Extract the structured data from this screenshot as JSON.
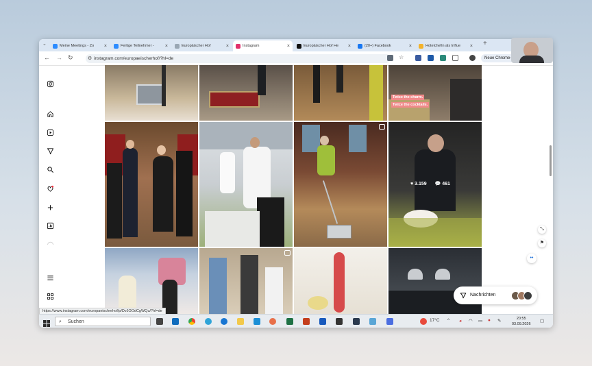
{
  "browser": {
    "tabs": [
      {
        "label": "Meine Meetings - Zo",
        "icon": "zoom-icon",
        "color": "#2d8cff"
      },
      {
        "label": "Fertige Teilnehmer -",
        "icon": "zoom-icon",
        "color": "#2d8cff"
      },
      {
        "label": "Europäischer Hof",
        "icon": "globe-icon",
        "color": "#9aa7b4"
      },
      {
        "label": "Instagram",
        "icon": "instagram-icon",
        "color": "#e1306c"
      },
      {
        "label": "Europäischer Hof He",
        "icon": "tiktok-icon",
        "color": "#111111"
      },
      {
        "label": "(20+) Facebook",
        "icon": "facebook-icon",
        "color": "#1877f2"
      },
      {
        "label": "Hotelchefin als Influe",
        "icon": "bookmark-icon",
        "color": "#f3b22b"
      }
    ],
    "new_tab": "+",
    "url": "instagram.com/europaeischerhof/?hl=de",
    "profile_label": "Neue Chrome-",
    "status_url": "https://www.instagram.com/europaeischerhof/p/DvJOOdCgWQu/?hl=de"
  },
  "instagram": {
    "sidebar": [
      "instagram-logo-icon",
      "home-icon",
      "reels-icon",
      "direct-icon",
      "search-icon",
      "notifications-icon",
      "create-icon",
      "dashboard-icon",
      "threads-icon",
      "menu-icon",
      "more-icon"
    ],
    "posts": [
      {
        "row": 0,
        "col": 0,
        "desc": "trolley"
      },
      {
        "row": 0,
        "col": 1,
        "desc": "luggage cart"
      },
      {
        "row": 0,
        "col": 2,
        "desc": "legs"
      },
      {
        "row": 0,
        "col": 3,
        "desc": "bar",
        "overlay_lines": [
          "Twice the charm.",
          "Twice the cocktails."
        ]
      },
      {
        "row": 1,
        "col": 0,
        "desc": "group staircase"
      },
      {
        "row": 1,
        "col": 1,
        "desc": "waiters"
      },
      {
        "row": 1,
        "col": 2,
        "desc": "vacuum",
        "reel": true
      },
      {
        "row": 1,
        "col": 3,
        "desc": "chef",
        "likes": "3.159",
        "comments": "461"
      },
      {
        "row": 2,
        "col": 0,
        "desc": "panel"
      },
      {
        "row": 2,
        "col": 1,
        "desc": "people",
        "reel": true
      },
      {
        "row": 2,
        "col": 2,
        "desc": "food"
      },
      {
        "row": 2,
        "col": 3,
        "desc": "lamps"
      }
    ],
    "messages_label": "Nachrichten"
  },
  "taskbar": {
    "search_placeholder": "Suchen",
    "weather": "17°C",
    "time": "20:55",
    "date": "03.09.2026"
  }
}
